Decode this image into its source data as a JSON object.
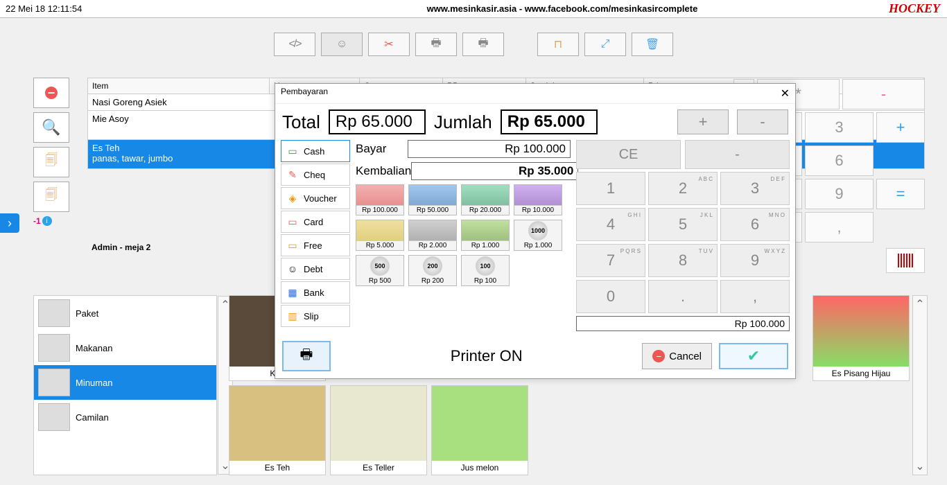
{
  "header": {
    "timestamp": "22 Mei 18 12:11:54",
    "title": "www.mesinkasir.asia - www.facebook.com/mesinkasircomplete",
    "brand": "HOCKEY"
  },
  "order": {
    "cols": {
      "item": "Item",
      "harga": "Harga",
      "qty": "Otv",
      "ppn": "PPn",
      "jumlah": "Jumlah",
      "printer": "Printer"
    },
    "rows": [
      {
        "item": "Nasi Goreng Asiek",
        "sub": ""
      },
      {
        "item": "Mie Asoy",
        "sub": ""
      },
      {
        "item": "Es Teh",
        "sub": "panas, tawar, jumbo",
        "selected": true
      }
    ],
    "footer": "Admin - meja 2",
    "neg1": "-1"
  },
  "categories": [
    {
      "label": "Paket"
    },
    {
      "label": "Makanan"
    },
    {
      "label": "Minuman",
      "selected": true
    },
    {
      "label": "Camilan"
    }
  ],
  "products": {
    "row1": [
      "Kop",
      "",
      "",
      "",
      "",
      "Es Pisang Hijau"
    ],
    "row2": [
      "Es Teh",
      "Es Teller",
      "Jus melon"
    ]
  },
  "modal": {
    "title": "Pembayaran",
    "total_label": "Total",
    "total_value": "Rp 65.000",
    "jumlah_label": "Jumlah",
    "jumlah_value": "Rp 65.000",
    "bayar_label": "Bayar",
    "bayar_value": "Rp 100.000",
    "kembalian_label": "Kembalian",
    "kembalian_value": "Rp 35.000",
    "paytabs": [
      "Cash",
      "Cheq",
      "Voucher",
      "Card",
      "Free",
      "Debt",
      "Bank",
      "Slip"
    ],
    "denoms": [
      "Rp 100.000",
      "Rp 50.000",
      "Rp 20.000",
      "Rp 10.000",
      "Rp 5.000",
      "Rp 2.000",
      "Rp 1.000",
      "Rp 1.000",
      "Rp 500",
      "Rp 200",
      "Rp 100"
    ],
    "numtop": [
      "CE",
      "-"
    ],
    "numkeys": [
      {
        "n": "1"
      },
      {
        "n": "2",
        "s": "A\nB\nC"
      },
      {
        "n": "3",
        "s": "D\nE\nF"
      },
      {
        "n": "4",
        "s": "G\nH\nI"
      },
      {
        "n": "5",
        "s": "J\nK\nL"
      },
      {
        "n": "6",
        "s": "M\nN\nO"
      },
      {
        "n": "7",
        "s": "P\nQ\nR\nS"
      },
      {
        "n": "8",
        "s": "T\nU\nV"
      },
      {
        "n": "9",
        "s": "W\nX\nY\nZ"
      },
      {
        "n": "0"
      },
      {
        "n": "."
      },
      {
        "n": ","
      }
    ],
    "numdisplay": "Rp 100.000",
    "printer_status": "Printer ON",
    "cancel": "Cancel"
  },
  "slash": "/",
  "lt": "<",
  "gt": ">"
}
